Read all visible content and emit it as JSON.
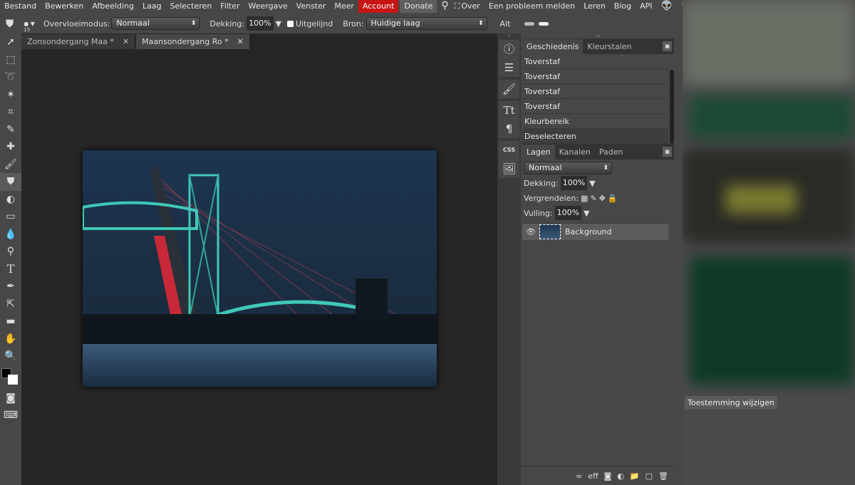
{
  "menu": {
    "items": [
      "Bestand",
      "Bewerken",
      "Afbeelding",
      "Laag",
      "Selecteren",
      "Filter",
      "Weergave",
      "Venster",
      "Meer"
    ],
    "account": "Account",
    "donate": "Donate",
    "over": "Over",
    "report": "Een probleem melden",
    "learn": "Leren",
    "blog": "Blog",
    "api": "API"
  },
  "options": {
    "brush_size": "15",
    "blend_label": "Overvloeimodus:",
    "blend_value": "Normaal",
    "opacity_label": "Dekking:",
    "opacity_value": "100%",
    "aligned_label": "Uitgelijnd",
    "source_label": "Bron:",
    "source_value": "Huidige laag",
    "alt_label": "Alt"
  },
  "tabs": [
    {
      "label": "Zonsondergang Maa *"
    },
    {
      "label": "Maansondergang Ro *"
    }
  ],
  "history": {
    "tabs": [
      "Geschiedenis",
      "Kleurstalen"
    ],
    "items": [
      "Toverstaf",
      "Toverstaf",
      "Toverstaf",
      "Toverstaf",
      "Kleurbereik",
      "Deselecteren"
    ]
  },
  "layers": {
    "tabs": [
      "Lagen",
      "Kanalen",
      "Paden"
    ],
    "blend": "Normaal",
    "opacity_label": "Dekking:",
    "opacity": "100%",
    "lock_label": "Vergrendelen:",
    "fill_label": "Vulling:",
    "fill": "100%",
    "items": [
      {
        "name": "Background"
      }
    ],
    "footer": [
      "link-icon",
      "eff",
      "mask-icon",
      "adjustment-icon",
      "folder-icon",
      "new-layer-icon",
      "trash-icon"
    ]
  },
  "strip": {
    "css": "CSS"
  },
  "ad": {
    "consent_button": "Toestemming wijzigen"
  },
  "colors": {
    "account": "#c81414",
    "canvas": "#262626",
    "chrome": "#474747"
  }
}
